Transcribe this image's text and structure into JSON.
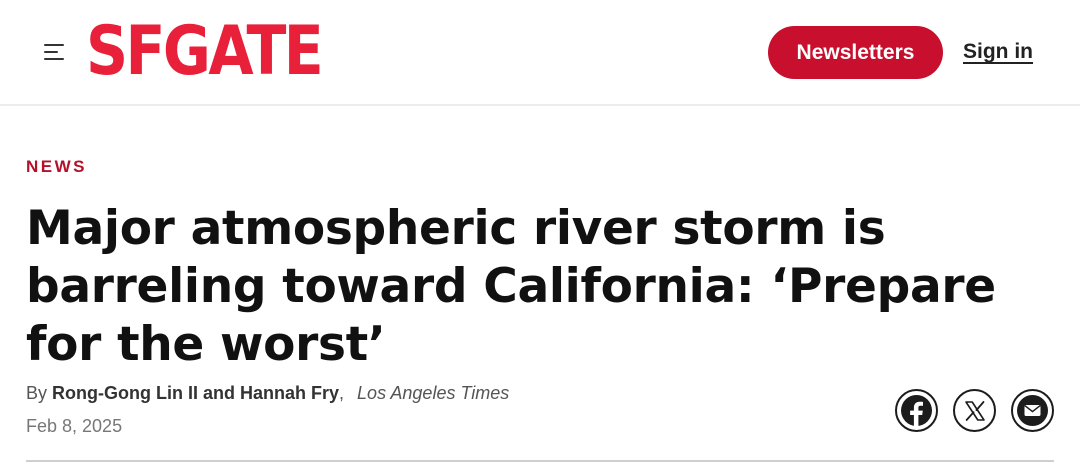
{
  "header": {
    "logo": "SFGATE",
    "newsletters_label": "Newsletters",
    "signin_label": "Sign in"
  },
  "article": {
    "category": "NEWS",
    "headline": "Major atmospheric river storm is barreling toward California: ‘Prepare for the worst’",
    "byline_prefix": "By",
    "authors": "Rong-Gong Lin II and Hannah Fry",
    "separator": ",",
    "publication": "Los Angeles Times",
    "date": "Feb 8, 2025"
  },
  "share": {
    "icons": [
      "facebook-icon",
      "x-icon",
      "email-icon"
    ]
  },
  "colors": {
    "brand": "#e8203a",
    "button": "#c8102e",
    "category": "#b5102a"
  }
}
